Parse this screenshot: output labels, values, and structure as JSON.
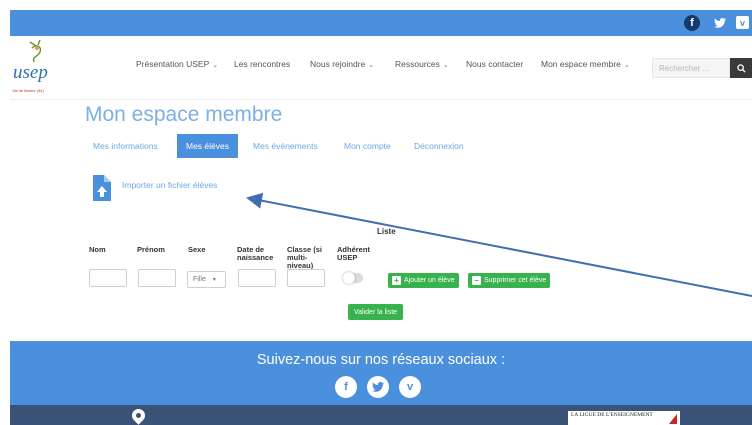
{
  "topbar": {
    "socials": [
      {
        "icon": "facebook-icon",
        "glyph": "f"
      },
      {
        "icon": "twitter-icon",
        "glyph": "🐦"
      },
      {
        "icon": "vimeo-icon",
        "glyph": "v"
      }
    ]
  },
  "nav": {
    "logo_text": "usep",
    "logo_subtext": "Val de Marne (94)",
    "items": [
      {
        "label": "Présentation USEP",
        "dropdown": true
      },
      {
        "label": "Les rencontres",
        "dropdown": false
      },
      {
        "label": "Nous rejoindre",
        "dropdown": true
      },
      {
        "label": "Ressources",
        "dropdown": true
      },
      {
        "label": "Nous contacter",
        "dropdown": false
      },
      {
        "label": "Mon espace membre",
        "dropdown": true
      }
    ],
    "search_placeholder": "Rechercher ..."
  },
  "main": {
    "title": "Mon espace membre",
    "tabs": [
      {
        "label": "Mes informations",
        "active": false
      },
      {
        "label": "Mes élèves",
        "active": true
      },
      {
        "label": "Mes événements",
        "active": false
      },
      {
        "label": "Mon compte",
        "active": false
      },
      {
        "label": "Déconnexion",
        "active": false
      }
    ],
    "import_label": "Importer un fichier élèves",
    "list_title": "Liste",
    "columns": [
      "Nom",
      "Prénom",
      "Sexe",
      "Date de naissance",
      "Classe (si multi-niveau)",
      "Adhérent USEP"
    ],
    "sex_value": "Fille",
    "add_button": "Ajouter un élève",
    "delete_button": "Supprimer cet élève",
    "validate_button": "Valider la liste"
  },
  "footer": {
    "social_title": "Suivez-nous sur nos réseaux sociaux :",
    "socials": [
      "facebook-icon",
      "twitter-icon",
      "vimeo-icon"
    ],
    "ligue_text": "LA LIGUE DE L'ENSEIGNEMENT"
  },
  "colors": {
    "accent": "#4a90dd",
    "title": "#7bb0e6",
    "green": "#37b24d",
    "footer_dark": "#3a5377"
  }
}
